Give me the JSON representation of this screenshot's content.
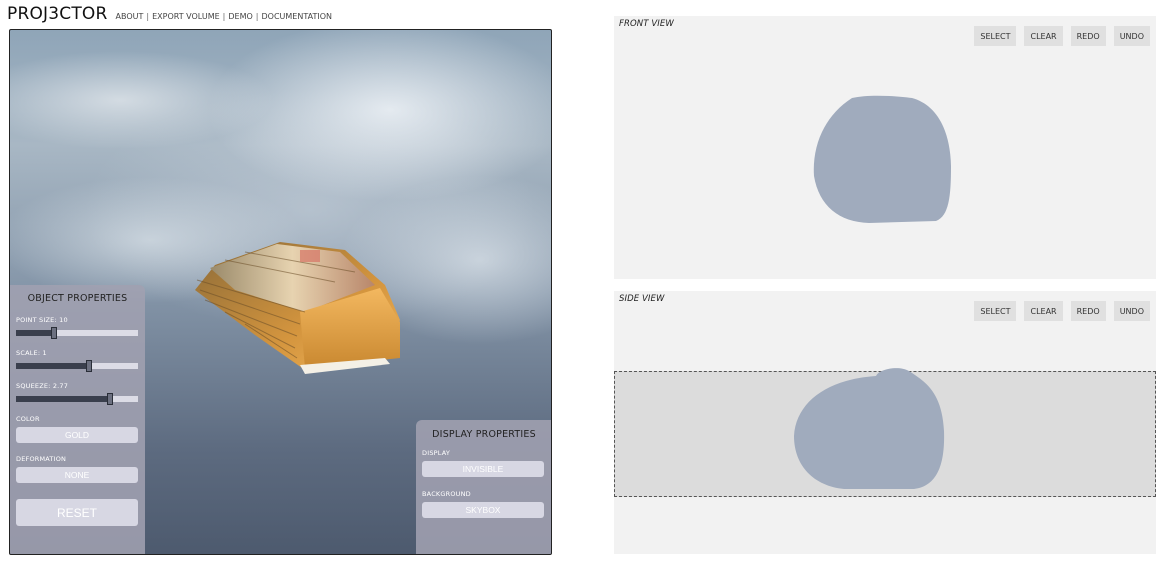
{
  "app": {
    "logo": "PROJ3CTOR"
  },
  "nav": {
    "about": "ABOUT",
    "export": "EXPORT VOLUME",
    "demo": "DEMO",
    "docs": "DOCUMENTATION",
    "sep": "|"
  },
  "object_properties": {
    "title": "OBJECT PROPERTIES",
    "point_size_label": "POINT SIZE: 10",
    "point_size_value": 0.31,
    "scale_label": "SCALE: 1",
    "scale_value": 0.6,
    "squeeze_label": "SQUEEZE: 2.77",
    "squeeze_value": 0.77,
    "color_label": "COLOR",
    "color_value": "GOLD",
    "deformation_label": "DEFORMATION",
    "deformation_value": "NONE",
    "reset_label": "RESET"
  },
  "display_properties": {
    "title": "DISPLAY PROPERTIES",
    "display_label": "DISPLAY",
    "display_value": "INVISIBLE",
    "background_label": "BACKGROUND",
    "background_value": "SKYBOX"
  },
  "front_view": {
    "title": "FRONT VIEW",
    "select": "SELECT",
    "clear": "CLEAR",
    "redo": "REDO",
    "undo": "UNDO"
  },
  "side_view": {
    "title": "SIDE VIEW",
    "select": "SELECT",
    "clear": "CLEAR",
    "redo": "REDO",
    "undo": "UNDO"
  },
  "colors": {
    "shape_fill": "#a0abbd",
    "object_gold": "#d99a3c",
    "panel_bg": "#a0a0b0"
  }
}
